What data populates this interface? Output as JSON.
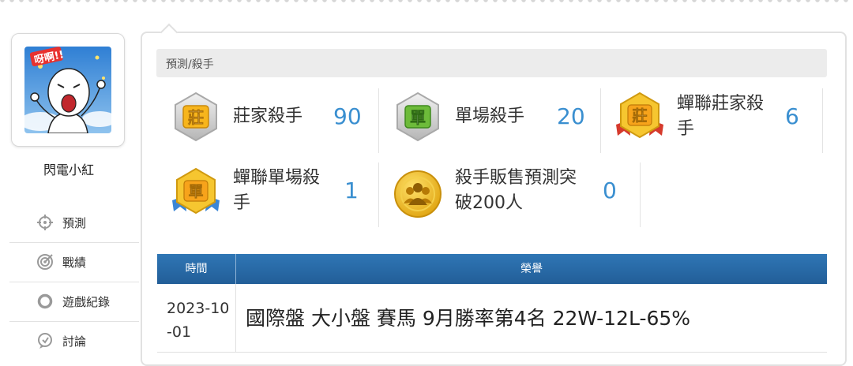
{
  "user": {
    "name": "閃電小紅",
    "avatar_text": "呀啊!!"
  },
  "sidebar": {
    "items": [
      {
        "label": "預測",
        "icon": "crosshair-icon"
      },
      {
        "label": "戰績",
        "icon": "target-icon"
      },
      {
        "label": "遊戲紀錄",
        "icon": "ring-icon"
      },
      {
        "label": "討論",
        "icon": "comment-icon"
      }
    ]
  },
  "section": {
    "title": "預測/殺手"
  },
  "badges": [
    {
      "label": "莊家殺手",
      "count": "90",
      "glyph": "莊",
      "icon": "silver-hexagon-badge-icon"
    },
    {
      "label": "單場殺手",
      "count": "20",
      "glyph": "單",
      "icon": "silver-hexagon-badge-icon"
    },
    {
      "label": "蟬聯莊家殺手",
      "count": "6",
      "glyph": "莊",
      "icon": "gold-ribbon-badge-icon"
    },
    {
      "label": "蟬聯單場殺手",
      "count": "1",
      "glyph": "單",
      "icon": "gold-ribbon-badge-icon"
    },
    {
      "label": "殺手販售預測突破200人",
      "count": "0",
      "icon": "gold-people-medal-icon"
    }
  ],
  "honors": {
    "headers": {
      "time": "時間",
      "honor": "榮譽"
    },
    "rows": [
      {
        "time": "2023-10-01",
        "honor": "國際盤 大小盤 賽馬 9月勝率第4名 22W-12L-65%"
      }
    ]
  },
  "colors": {
    "accent": "#3a8fd0",
    "table_header": "#2a6aa8",
    "gold": "#f2b81d",
    "silver": "#c9c9c9"
  }
}
